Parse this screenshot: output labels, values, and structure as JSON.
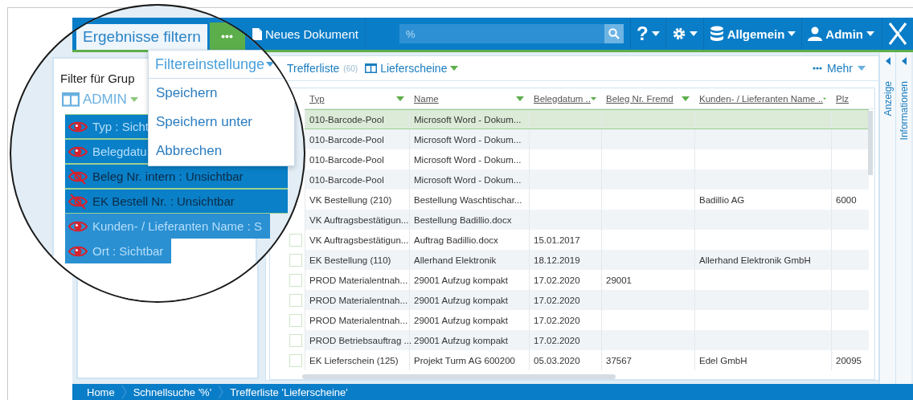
{
  "magnifier": {
    "tab": {
      "label": "Ergebnisse filtern",
      "selected": true
    },
    "filter_panel": {
      "title": "Filter für Grup",
      "layout": "ADMIN",
      "items": [
        {
          "label": "Typ : Sicht",
          "visible": true,
          "selected": true
        },
        {
          "label": "Belegdatu",
          "visible": true,
          "selected": true
        },
        {
          "label": "Beleg Nr. intern : Unsichtbar",
          "visible": false,
          "selected": true
        },
        {
          "label": "EK Bestell Nr. : Unsichtbar",
          "visible": false,
          "selected": true
        },
        {
          "label": "Kunden- / Lieferanten Name : S",
          "visible": true,
          "selected": false
        },
        {
          "label": "Ort : Sichtbar",
          "visible": true,
          "selected": false
        }
      ]
    },
    "menu": {
      "title": "Filtereinstellunge",
      "items": [
        "Speichern",
        "Speichern unter",
        "Abbrechen"
      ]
    }
  },
  "top_bar": {
    "new_document": "Neues Dokument",
    "search": {
      "value": "%"
    },
    "help": "?",
    "database": "Allgemein",
    "user": "Admin"
  },
  "results": {
    "title": "Trefferliste",
    "count": "(60)",
    "layout": "Lieferscheine",
    "more": "Mehr",
    "columns": [
      {
        "label": "Typ",
        "filter": true
      },
      {
        "label": "Name",
        "filter": true
      },
      {
        "label": "Belegdatum ..",
        "filter": true
      },
      {
        "label": "Beleg Nr. Fremd",
        "filter": true
      },
      {
        "label": "Kunden- / Lieferanten Name ..",
        "filter": true
      },
      {
        "label": "Plz",
        "filter": false
      }
    ],
    "rows": [
      {
        "selected": true,
        "cells": [
          "010-Barcode-Pool",
          "Microsoft Word - Dokum...",
          "",
          "",
          "",
          ""
        ]
      },
      {
        "selected": false,
        "cells": [
          "010-Barcode-Pool",
          "Microsoft Word - Dokum...",
          "",
          "",
          "",
          ""
        ]
      },
      {
        "selected": false,
        "cells": [
          "010-Barcode-Pool",
          "Microsoft Word - Dokum...",
          "",
          "",
          "",
          ""
        ]
      },
      {
        "selected": false,
        "cells": [
          "010-Barcode-Pool",
          "Microsoft Word - Dokum...",
          "",
          "",
          "",
          ""
        ]
      },
      {
        "selected": false,
        "cells": [
          "VK Bestellung (210)",
          "Bestellung Waschtischar...",
          "",
          "",
          "Badillio AG",
          "6000"
        ]
      },
      {
        "selected": false,
        "cells": [
          "VK Auftragsbestätigun...",
          "Bestellung Badillio.docx",
          "",
          "",
          "",
          ""
        ]
      },
      {
        "selected": false,
        "checked": false,
        "cells": [
          "VK Auftragsbestätigun...",
          "Auftrag Badillio.docx",
          "15.01.2017",
          "",
          "",
          ""
        ]
      },
      {
        "selected": false,
        "checked": false,
        "cells": [
          "EK Bestellung (110)",
          "Allerhand Elektronik",
          "18.12.2019",
          "",
          "Allerhand Elektronik GmbH",
          ""
        ]
      },
      {
        "selected": false,
        "checked": false,
        "cells": [
          "PROD Materialentnah...",
          "29001 Aufzug kompakt",
          "17.02.2020",
          "29001",
          "",
          ""
        ]
      },
      {
        "selected": false,
        "checked": false,
        "cells": [
          "PROD Materialentnah...",
          "29001 Aufzug kompakt",
          "17.02.2020",
          "",
          "",
          ""
        ]
      },
      {
        "selected": false,
        "checked": false,
        "cells": [
          "PROD Materialentnah...",
          "29001 Aufzug kompakt",
          "17.02.2020",
          "",
          "",
          ""
        ]
      },
      {
        "selected": false,
        "checked": false,
        "cells": [
          "PROD Betriebsauftrag ...",
          "29001 Aufzug kompakt",
          "17.02.2020",
          "",
          "",
          ""
        ]
      },
      {
        "selected": false,
        "checked": false,
        "cells": [
          "EK Lieferschein (125)",
          "Projekt Turm AG 600200",
          "05.03.2020",
          "37567",
          "Edel GmbH",
          "20095"
        ]
      }
    ]
  },
  "side_panels": [
    "Anzeige",
    "Informationen"
  ],
  "breadcrumb": [
    "Home",
    "Schnellsuche '%'",
    "Trefferliste 'Lieferscheine'"
  ]
}
